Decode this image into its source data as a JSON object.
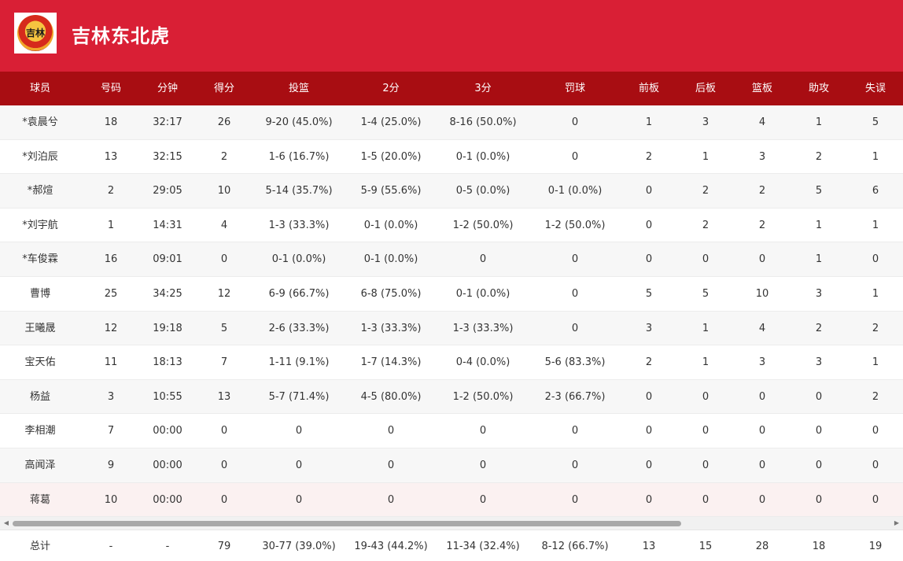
{
  "team": {
    "name": "吉林东北虎",
    "logo_text": "吉林"
  },
  "columns": [
    "球员",
    "号码",
    "分钟",
    "得分",
    "投篮",
    "2分",
    "3分",
    "罚球",
    "前板",
    "后板",
    "篮板",
    "助攻",
    "失误"
  ],
  "players": [
    [
      "*袁晨兮",
      "18",
      "32:17",
      "26",
      "9-20 (45.0%)",
      "1-4 (25.0%)",
      "8-16 (50.0%)",
      "0",
      "1",
      "3",
      "4",
      "1",
      "5"
    ],
    [
      "*刘泊辰",
      "13",
      "32:15",
      "2",
      "1-6 (16.7%)",
      "1-5 (20.0%)",
      "0-1 (0.0%)",
      "0",
      "2",
      "1",
      "3",
      "2",
      "1"
    ],
    [
      "*郝煊",
      "2",
      "29:05",
      "10",
      "5-14 (35.7%)",
      "5-9 (55.6%)",
      "0-5 (0.0%)",
      "0-1 (0.0%)",
      "0",
      "2",
      "2",
      "5",
      "6"
    ],
    [
      "*刘宇航",
      "1",
      "14:31",
      "4",
      "1-3 (33.3%)",
      "0-1 (0.0%)",
      "1-2 (50.0%)",
      "1-2 (50.0%)",
      "0",
      "2",
      "2",
      "1",
      "1"
    ],
    [
      "*车俊霖",
      "16",
      "09:01",
      "0",
      "0-1 (0.0%)",
      "0-1 (0.0%)",
      "0",
      "0",
      "0",
      "0",
      "0",
      "1",
      "0"
    ],
    [
      "曹博",
      "25",
      "34:25",
      "12",
      "6-9 (66.7%)",
      "6-8 (75.0%)",
      "0-1 (0.0%)",
      "0",
      "5",
      "5",
      "10",
      "3",
      "1"
    ],
    [
      "王曦晟",
      "12",
      "19:18",
      "5",
      "2-6 (33.3%)",
      "1-3 (33.3%)",
      "1-3 (33.3%)",
      "0",
      "3",
      "1",
      "4",
      "2",
      "2"
    ],
    [
      "宝天佑",
      "11",
      "18:13",
      "7",
      "1-11 (9.1%)",
      "1-7 (14.3%)",
      "0-4 (0.0%)",
      "5-6 (83.3%)",
      "2",
      "1",
      "3",
      "3",
      "1"
    ],
    [
      "杨益",
      "3",
      "10:55",
      "13",
      "5-7 (71.4%)",
      "4-5 (80.0%)",
      "1-2 (50.0%)",
      "2-3 (66.7%)",
      "0",
      "0",
      "0",
      "0",
      "2"
    ],
    [
      "李相潮",
      "7",
      "00:00",
      "0",
      "0",
      "0",
      "0",
      "0",
      "0",
      "0",
      "0",
      "0",
      "0"
    ],
    [
      "高闻泽",
      "9",
      "00:00",
      "0",
      "0",
      "0",
      "0",
      "0",
      "0",
      "0",
      "0",
      "0",
      "0"
    ],
    [
      "蒋葛",
      "10",
      "00:00",
      "0",
      "0",
      "0",
      "0",
      "0",
      "0",
      "0",
      "0",
      "0",
      "0"
    ]
  ],
  "totals": [
    "总计",
    "-",
    "-",
    "79",
    "30-77 (39.0%)",
    "19-43 (44.2%)",
    "11-34 (32.4%)",
    "8-12 (66.7%)",
    "13",
    "15",
    "28",
    "18",
    "19"
  ],
  "scrollbar": {
    "left_arrow": "◀",
    "right_arrow": "▶"
  },
  "colors": {
    "header_bg": "#d91f35",
    "table_head_bg": "#a80d12"
  }
}
